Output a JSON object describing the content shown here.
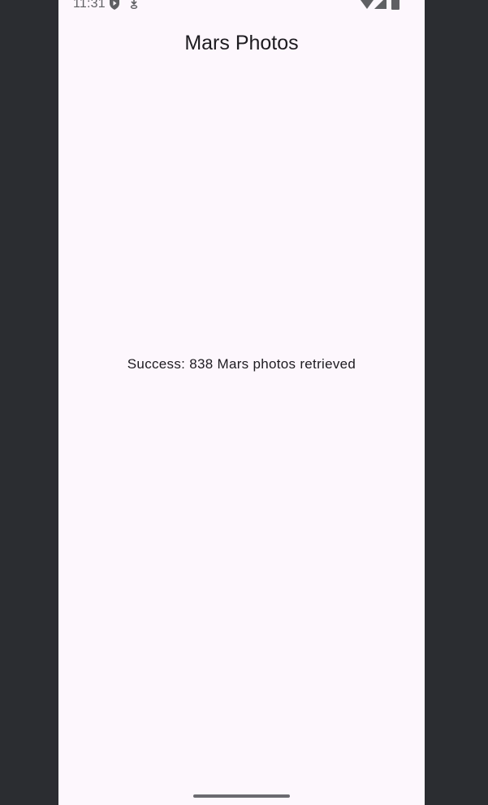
{
  "status_bar": {
    "time": "11:31",
    "icons": [
      "play-protect-icon",
      "download-icon",
      "wifi-icon",
      "signal-icon",
      "battery-icon"
    ],
    "icon_color": "#5f5f63"
  },
  "app_bar": {
    "title": "Mars Photos"
  },
  "main": {
    "result_text": "Success: 838 Mars photos retrieved"
  },
  "colors": {
    "background": "#fdf7fd",
    "frame": "#2b2d31",
    "text": "#1d1b20"
  }
}
